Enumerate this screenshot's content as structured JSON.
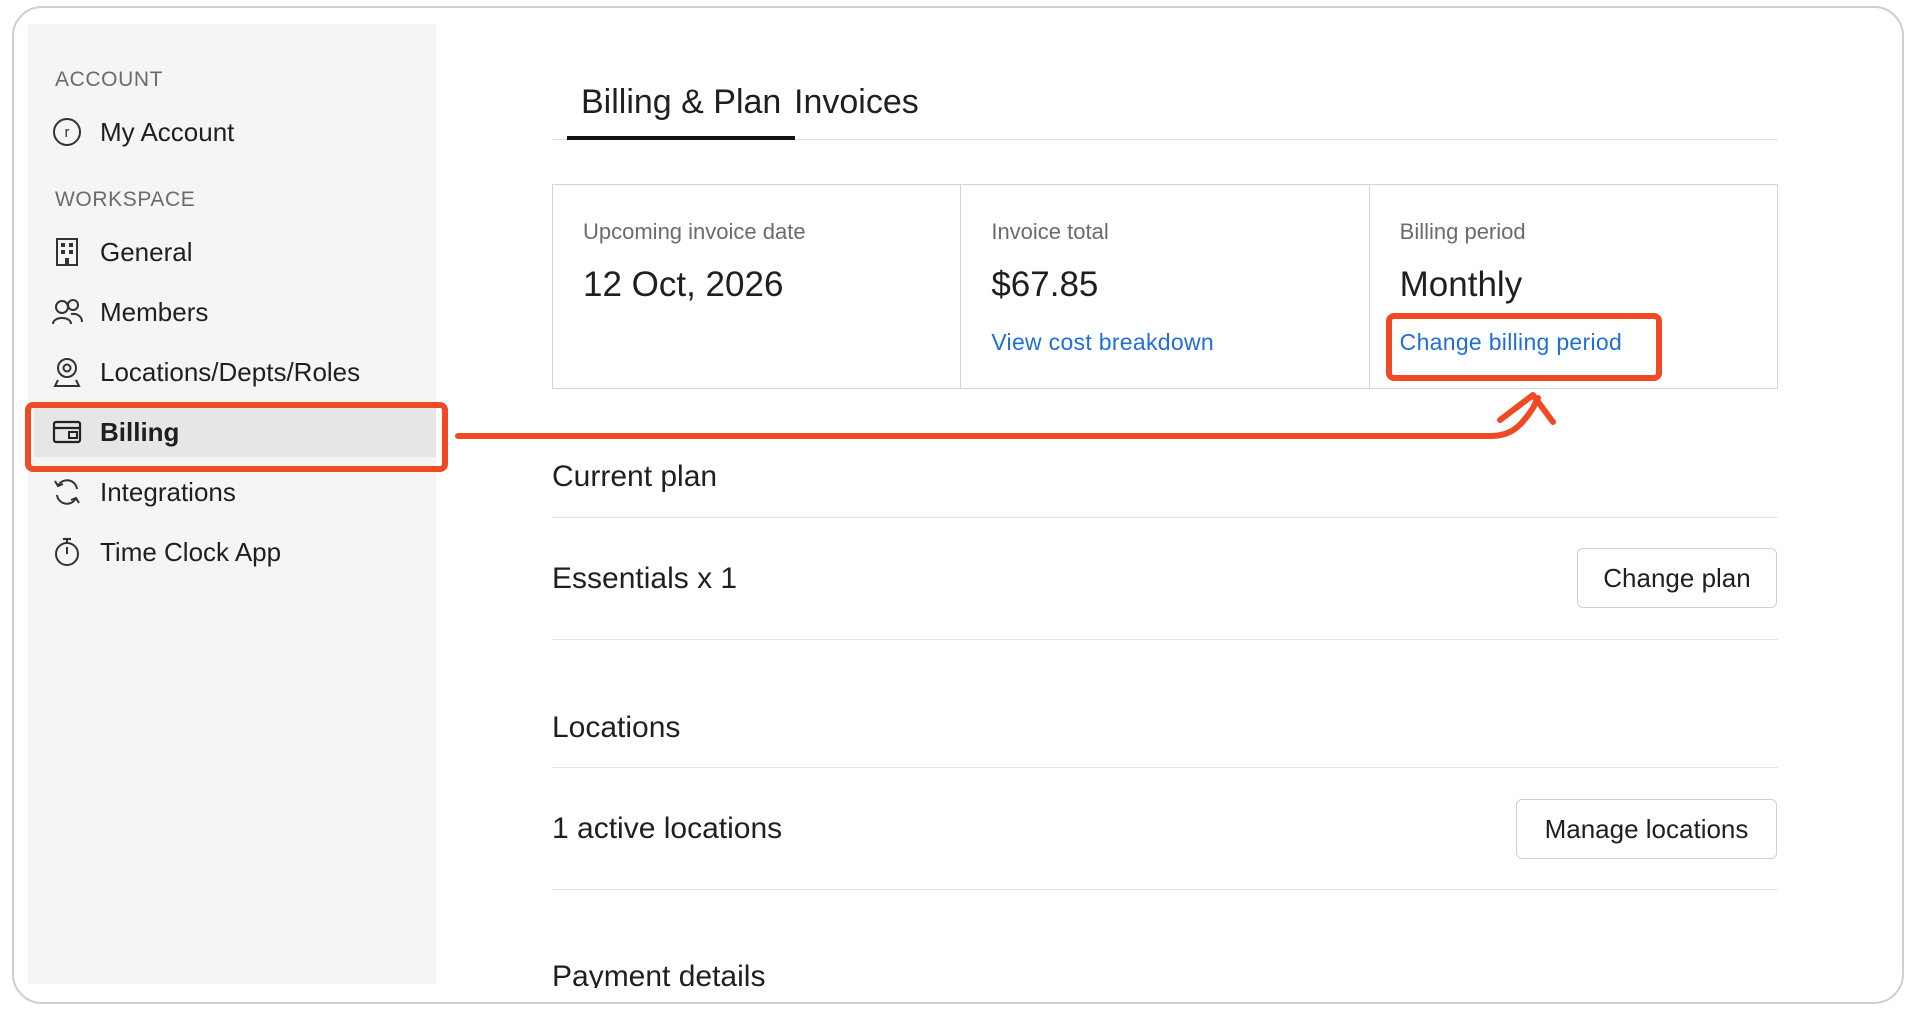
{
  "sidebar": {
    "account_label": "ACCOUNT",
    "workspace_label": "WORKSPACE",
    "items": [
      {
        "label": "My Account",
        "icon": "user-circle-icon"
      },
      {
        "label": "General",
        "icon": "building-icon"
      },
      {
        "label": "Members",
        "icon": "members-icon"
      },
      {
        "label": "Locations/Depts/Roles",
        "icon": "location-pin-icon"
      },
      {
        "label": "Billing",
        "icon": "wallet-icon",
        "active": true
      },
      {
        "label": "Integrations",
        "icon": "sync-icon"
      },
      {
        "label": "Time Clock App",
        "icon": "stopwatch-icon"
      }
    ]
  },
  "tabs": [
    {
      "label": "Billing & Plan",
      "active": true
    },
    {
      "label": "Invoices",
      "active": false
    }
  ],
  "stats": {
    "invoice_date": {
      "label": "Upcoming invoice date",
      "value": "12 Oct, 2026"
    },
    "invoice_total": {
      "label": "Invoice total",
      "value": "$67.85",
      "link": "View cost breakdown"
    },
    "billing_period": {
      "label": "Billing period",
      "value": "Monthly",
      "link": "Change billing period"
    }
  },
  "current_plan": {
    "title": "Current plan",
    "plan_text": "Essentials x 1",
    "button": "Change plan"
  },
  "locations": {
    "title": "Locations",
    "text": "1 active locations",
    "button": "Manage locations"
  },
  "payment": {
    "title": "Payment details"
  },
  "colors": {
    "accent_link": "#1f6fd6",
    "annotation": "#ef4a23"
  }
}
